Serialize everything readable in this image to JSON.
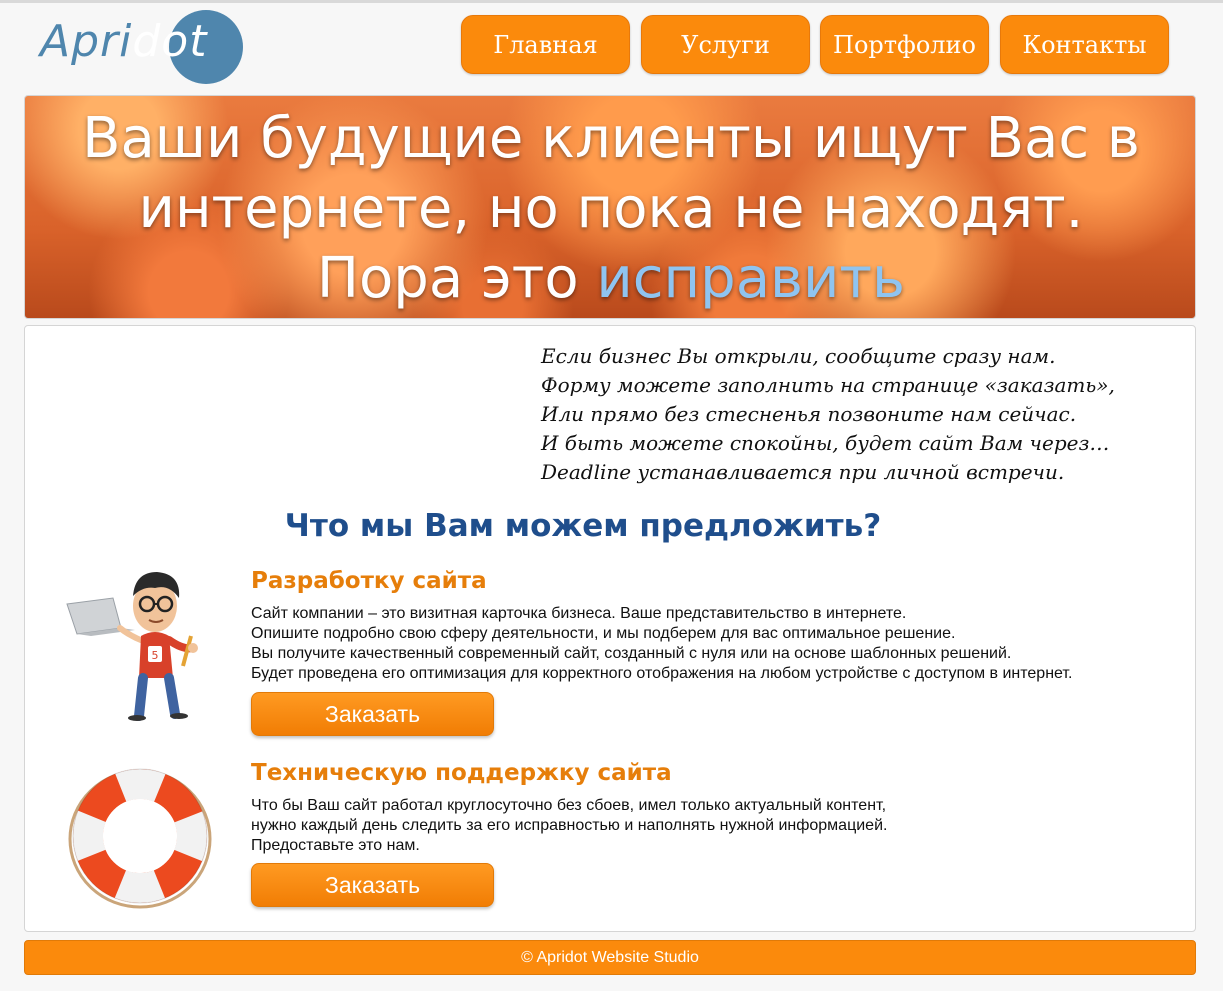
{
  "header": {
    "logo": {
      "part1": "Apri",
      "part2": "dot"
    },
    "nav": [
      "Главная",
      "Услуги",
      "Портфолио",
      "Контакты"
    ]
  },
  "hero": {
    "line1": "Ваши будущие клиенты ищут Вас в",
    "line2": "интернете, но пока не находят.",
    "line3_prefix": "Пора это ",
    "line3_accent": "исправить"
  },
  "poem": [
    "Если бизнес Вы открыли, сообщите сразу нам.",
    "Форму можете заполнить на странице «заказать»,",
    "Или прямо без стесненья позвоните нам сейчас.",
    "И быть можете спокойны, будет сайт Вам через…",
    "Deadline устанавливается при личной встречи."
  ],
  "offer": {
    "title": "Что мы Вам можем предложить?",
    "services": [
      {
        "title": "Разработку сайта",
        "lines": [
          "Сайт компании – это визитная карточка бизнеса. Ваше представительство в интернете.",
          "Опишите подробно свою сферу деятельности, и мы подберем для вас оптимальное решение.",
          "Вы получите качественный современный сайт, созданный с нуля или на основе шаблонных решений.",
          "Будет проведена его оптимизация для корректного отображения на любом устройстве с доступом в интернет."
        ],
        "button": "Заказать"
      },
      {
        "title": "Техническую поддержку сайта",
        "lines": [
          "Что бы Ваш сайт работал круглосуточно без сбоев, имел только актуальный контент,",
          "нужно каждый день следить за его исправностью и наполнять нужной информацией.",
          "Предоставьте это нам."
        ],
        "button": "Заказать"
      }
    ]
  },
  "footer": {
    "text": "© Apridot Website Studio"
  },
  "colors": {
    "accent": "#fb8a0c",
    "logo_blue": "#4f86ad",
    "title_blue": "#1f4e8c",
    "service_orange": "#e67e0a"
  }
}
